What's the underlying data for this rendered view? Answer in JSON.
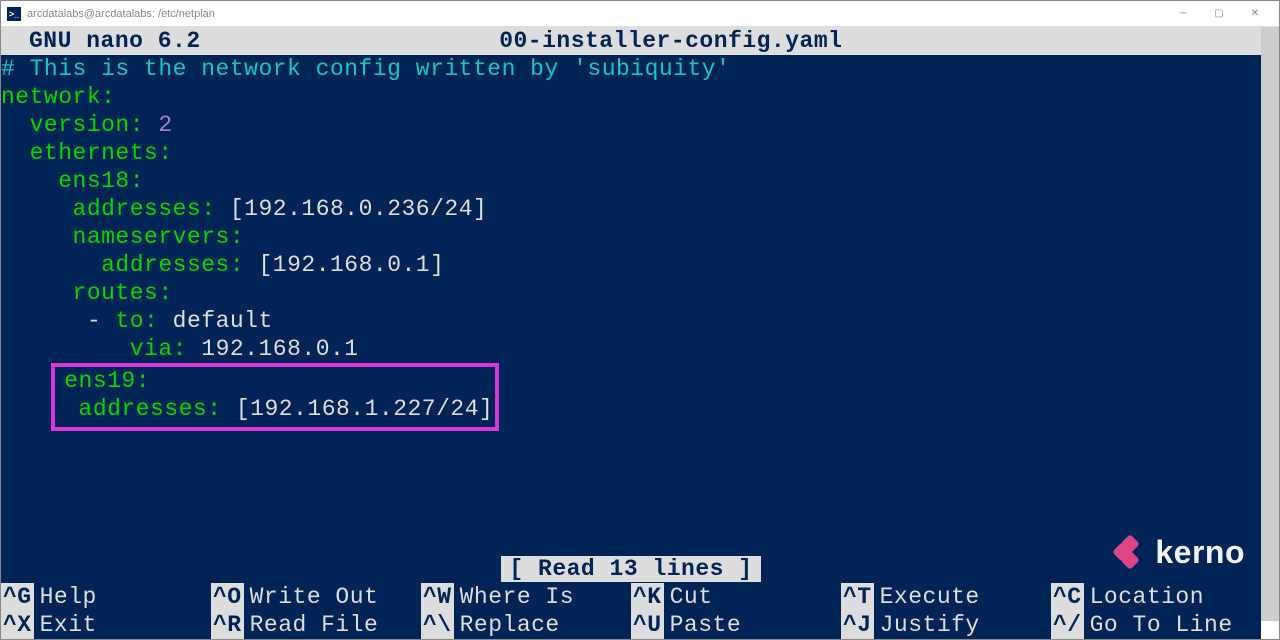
{
  "window": {
    "title": "arcdatalabs@arcdatalabs: /etc/netplan",
    "icon_glyph": ">_"
  },
  "nano": {
    "app": "GNU nano 6.2",
    "filename": "00-installer-config.yaml",
    "status": "[ Read 13 lines ]"
  },
  "yaml": {
    "comment": "# This is the network config written by 'subiquity'",
    "lines": {
      "network_key": "network",
      "version_key": "version",
      "version_val": "2",
      "ethernets_key": "ethernets",
      "ens18_key": "ens18",
      "ens18_addresses_key": "addresses",
      "ens18_addresses_val": "[192.168.0.236/24]",
      "nameservers_key": "nameservers",
      "ns_addresses_key": "addresses",
      "ns_addresses_val": "[192.168.0.1]",
      "routes_key": "routes",
      "route_to_key": "to",
      "route_to_val": "default",
      "route_via_key": "via",
      "route_via_val": "192.168.0.1",
      "ens19_key": "ens19",
      "ens19_addresses_key": "addresses",
      "ens19_addresses_val": "[192.168.1.227/24]"
    }
  },
  "shortcuts": {
    "row1": [
      {
        "key": "^G",
        "label": "Help"
      },
      {
        "key": "^O",
        "label": "Write Out"
      },
      {
        "key": "^W",
        "label": "Where Is"
      },
      {
        "key": "^K",
        "label": "Cut"
      },
      {
        "key": "^T",
        "label": "Execute"
      },
      {
        "key": "^C",
        "label": "Location"
      }
    ],
    "row2": [
      {
        "key": "^X",
        "label": "Exit"
      },
      {
        "key": "^R",
        "label": "Read File"
      },
      {
        "key": "^\\",
        "label": "Replace"
      },
      {
        "key": "^U",
        "label": "Paste"
      },
      {
        "key": "^J",
        "label": "Justify"
      },
      {
        "key": "^/",
        "label": "Go To Line"
      }
    ]
  },
  "watermark": {
    "text": "kerno"
  }
}
